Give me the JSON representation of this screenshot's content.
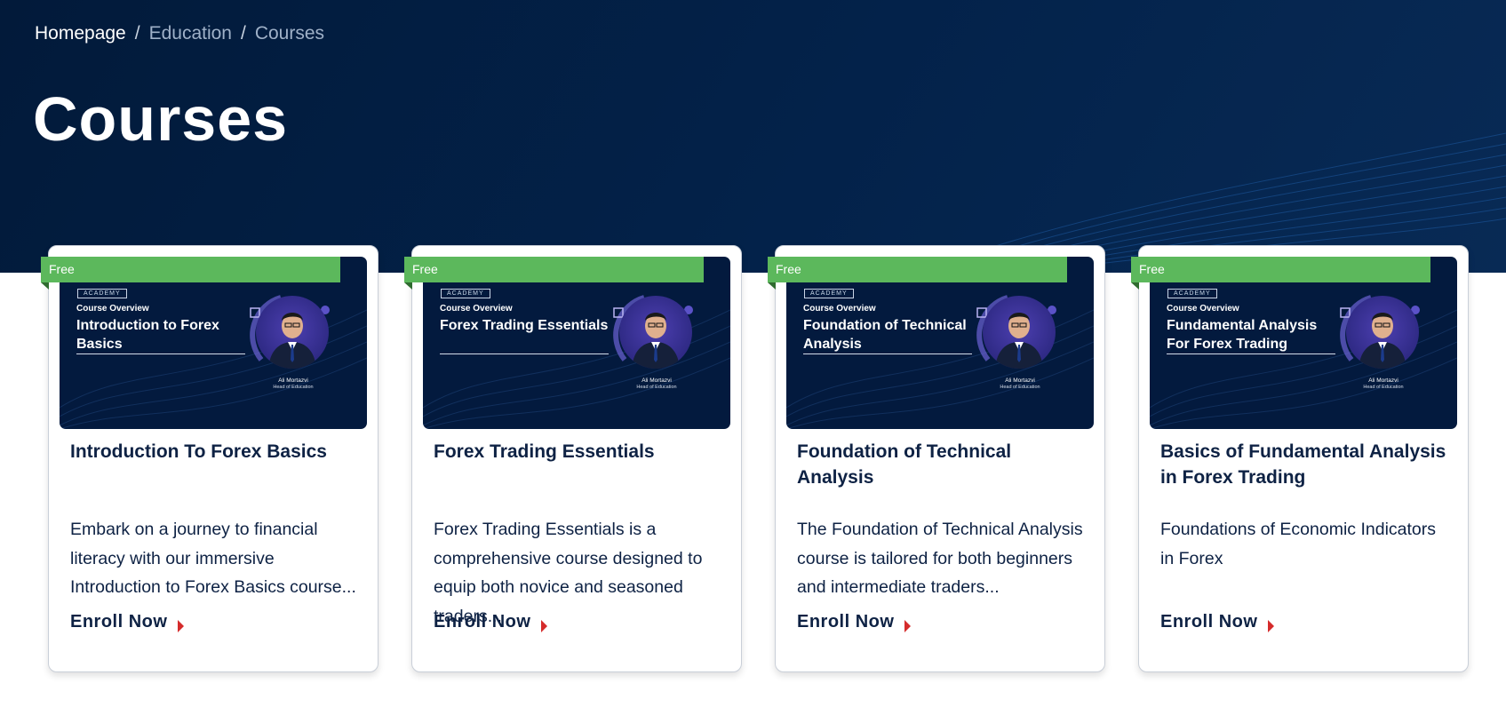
{
  "breadcrumb": {
    "home": "Homepage",
    "separator": "/",
    "education": "Education",
    "current": "Courses"
  },
  "page_title": "Courses",
  "colors": {
    "hero_bg": "#03224a",
    "free_badge": "#5cb85c",
    "arrow": "#d52b2b",
    "text_dark": "#0e2244"
  },
  "cards": [
    {
      "badge": "Free",
      "thumb_academy": "ACADEMY",
      "thumb_overview": "Course Overview",
      "thumb_title": "Introduction to Forex Basics",
      "thumb_name": "Ali Mortazvi",
      "thumb_role": "Head of Education",
      "title": "Introduction To Forex Basics",
      "description": "Embark on a journey to financial literacy with our immersive Introduction to Forex Basics course...",
      "cta": "Enroll Now",
      "cta_icon": "chevron-right-icon"
    },
    {
      "badge": "Free",
      "thumb_academy": "ACADEMY",
      "thumb_overview": "Course Overview",
      "thumb_title": "Forex Trading Essentials",
      "thumb_name": "Ali Mortazvi",
      "thumb_role": "Head of Education",
      "title": "Forex Trading Essentials",
      "description": "Forex Trading Essentials is a comprehensive course designed to equip both novice and seasoned traders...",
      "cta": "Enroll Now",
      "cta_icon": "chevron-right-icon"
    },
    {
      "badge": "Free",
      "thumb_academy": "ACADEMY",
      "thumb_overview": "Course Overview",
      "thumb_title": "Foundation of Technical Analysis",
      "thumb_name": "Ali Mortazvi",
      "thumb_role": "Head of Education",
      "title": "Foundation of Technical Analysis",
      "description": "The Foundation of Technical Analysis course is tailored for both beginners and intermediate traders...",
      "cta": "Enroll Now",
      "cta_icon": "chevron-right-icon"
    },
    {
      "badge": "Free",
      "thumb_academy": "ACADEMY",
      "thumb_overview": "Course Overview",
      "thumb_title": "Fundamental Analysis For Forex Trading",
      "thumb_name": "Ali Mortazvi",
      "thumb_role": "Head of Education",
      "title": "Basics of Fundamental Analysis in Forex Trading",
      "description": "Foundations of Economic Indicators in Forex",
      "cta": "Enroll Now",
      "cta_icon": "chevron-right-icon"
    }
  ]
}
